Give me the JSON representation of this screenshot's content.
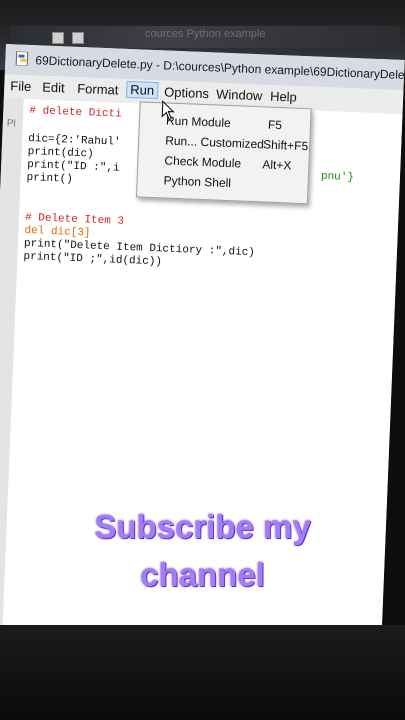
{
  "window": {
    "title": "69DictionaryDelete.py - D:\\cources\\Python example\\69DictionaryDelete.py",
    "background_title": "cources Python example"
  },
  "menubar": {
    "items": [
      "File",
      "Edit",
      "Format",
      "Run",
      "Options",
      "Window",
      "Help"
    ],
    "active": "Run"
  },
  "run_menu": {
    "items": [
      {
        "label": "Run Module",
        "shortcut": "F5"
      },
      {
        "label": "Run... Customized",
        "shortcut": "Shift+F5"
      },
      {
        "label": "Check Module",
        "shortcut": "Alt+X"
      },
      {
        "label": "Python Shell",
        "shortcut": ""
      }
    ]
  },
  "editor": {
    "gutter_text": "Pl",
    "lines": [
      {
        "text": "# delete Dicti",
        "kind": "comment"
      },
      {
        "text": "",
        "kind": "plain"
      },
      {
        "text": "dic={2:'Rahul'",
        "kind": "plain"
      },
      {
        "text": "print(dic)",
        "kind": "plain"
      },
      {
        "text": "print(\"ID :\",i",
        "kind": "plain"
      },
      {
        "text": "print()",
        "kind": "plain"
      },
      {
        "text": "",
        "kind": "plain"
      },
      {
        "text": "# Delete Item 3",
        "kind": "comment"
      },
      {
        "text": "del dic[3]",
        "kind": "kw"
      },
      {
        "text": "print(\"Delete Item Dictiory :\",dic)",
        "kind": "plain"
      },
      {
        "text": "print(\"ID ;\",id(dic))",
        "kind": "plain"
      }
    ],
    "right_fragment": "pnu'}"
  },
  "overlay": {
    "line1": "Subscribe my",
    "line2": "channel",
    "color": "#a27df5"
  },
  "taskbar": {
    "icons": [
      "windows-start-icon",
      "task-view-icon",
      "file-explorer-icon",
      "mail-icon",
      "store-icon",
      "edge-icon",
      "chrome-icon",
      "paint-icon",
      "media-player-icon",
      "python-icon",
      "obs-icon"
    ]
  }
}
